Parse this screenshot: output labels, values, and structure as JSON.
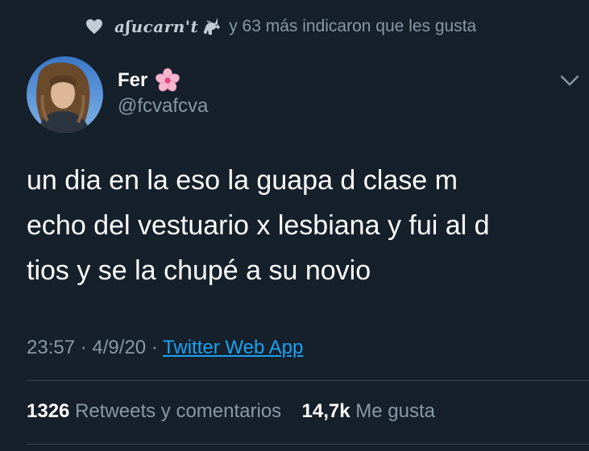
{
  "social_context": {
    "liker_name": "aʃucarn't",
    "liker_emoji": "unicorn-icon",
    "text": "y 63 más indicaron que les gusta"
  },
  "author": {
    "display_name": "Fer",
    "name_emoji": "cherry-blossom-icon",
    "handle": "@fcvafcva"
  },
  "tweet": {
    "lines": [
      "un dia en la eso la guapa d clase m",
      "echo del vestuario x lesbiana y fui al d",
      "tios y se la chupé a su novio"
    ]
  },
  "meta": {
    "time": "23:57",
    "date": "4/9/20",
    "separator": "·",
    "source": "Twitter Web App"
  },
  "stats": {
    "retweets_count": "1326",
    "retweets_label": "Retweets y comentarios",
    "likes_count": "14,7k",
    "likes_label": "Me gusta"
  },
  "colors": {
    "background": "#15202b",
    "secondary_text": "#8899a6",
    "link": "#1da1f2",
    "divider": "#38444d"
  }
}
